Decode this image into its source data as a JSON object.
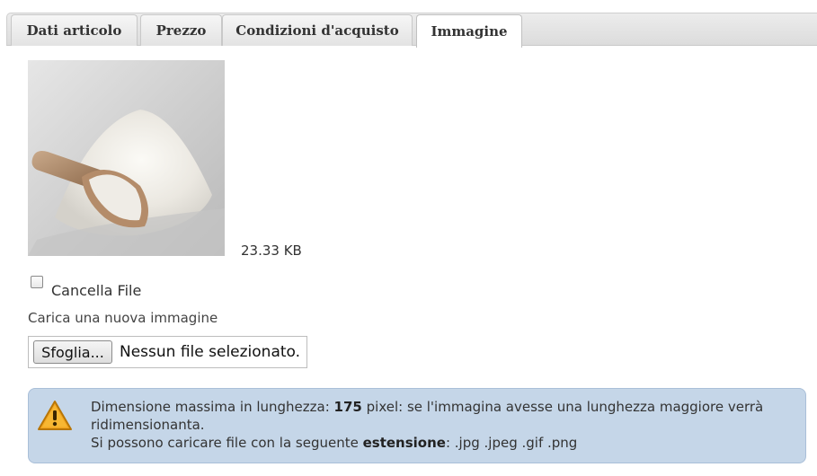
{
  "tabs": [
    {
      "label": "Dati articolo"
    },
    {
      "label": "Prezzo"
    },
    {
      "label": "Condizioni d'acquisto"
    },
    {
      "label": "Immagine",
      "active": true
    }
  ],
  "image": {
    "icon": "product-image-flour",
    "file_size": "23.33 KB"
  },
  "delete_checkbox": {
    "label": "Cancella File",
    "checked": false
  },
  "upload": {
    "label": "Carica una nuova immagine",
    "browse_label": "Sfoglia...",
    "no_file_text": "Nessun file selezionato."
  },
  "info": {
    "icon": "warning-icon",
    "line1_pre": "Dimensione massima in lunghezza: ",
    "line1_value": "175",
    "line1_post": " pixel: se l'immagina avesse una lunghezza maggiore verrà ridimensionanta.",
    "line2_pre": "Si possono caricare file con la seguente ",
    "line2_bold": "estensione",
    "line2_post": ": .jpg .jpeg .gif .png"
  },
  "colors": {
    "info_bg": "#c5d6e8",
    "warning": "#f3a51f"
  }
}
